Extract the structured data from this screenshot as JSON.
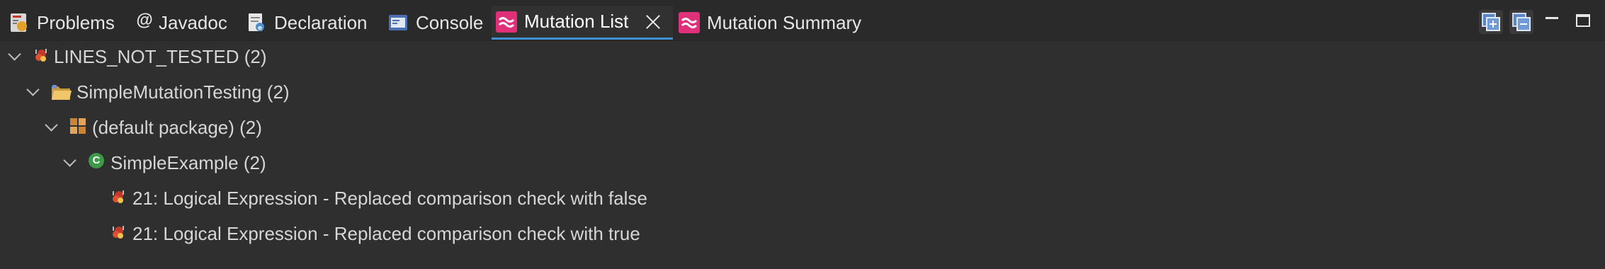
{
  "tabs": [
    {
      "label": "Problems",
      "icon": "problems-icon",
      "active": false
    },
    {
      "label": "Javadoc",
      "icon": "javadoc-icon",
      "active": false
    },
    {
      "label": "Declaration",
      "icon": "declaration-icon",
      "active": false
    },
    {
      "label": "Console",
      "icon": "console-icon",
      "active": false
    },
    {
      "label": "Mutation List",
      "icon": "mutation-icon",
      "active": true
    },
    {
      "label": "Mutation Summary",
      "icon": "mutation-icon",
      "active": false
    }
  ],
  "javadoc_symbol": "@",
  "tree": {
    "category": "LINES_NOT_TESTED (2)",
    "project": "SimpleMutationTesting (2)",
    "package": "(default package) (2)",
    "class": "SimpleExample (2)",
    "class_badge": "C",
    "mutations": [
      "21: Logical Expression - Replaced comparison check with false",
      "21: Logical Expression - Replaced comparison check with true"
    ]
  },
  "colors": {
    "background": "#2f2f2f",
    "active_tab_underline": "#3d8fd6",
    "mutation_icon": "#e0307a",
    "class_icon": "#3d9a48"
  }
}
